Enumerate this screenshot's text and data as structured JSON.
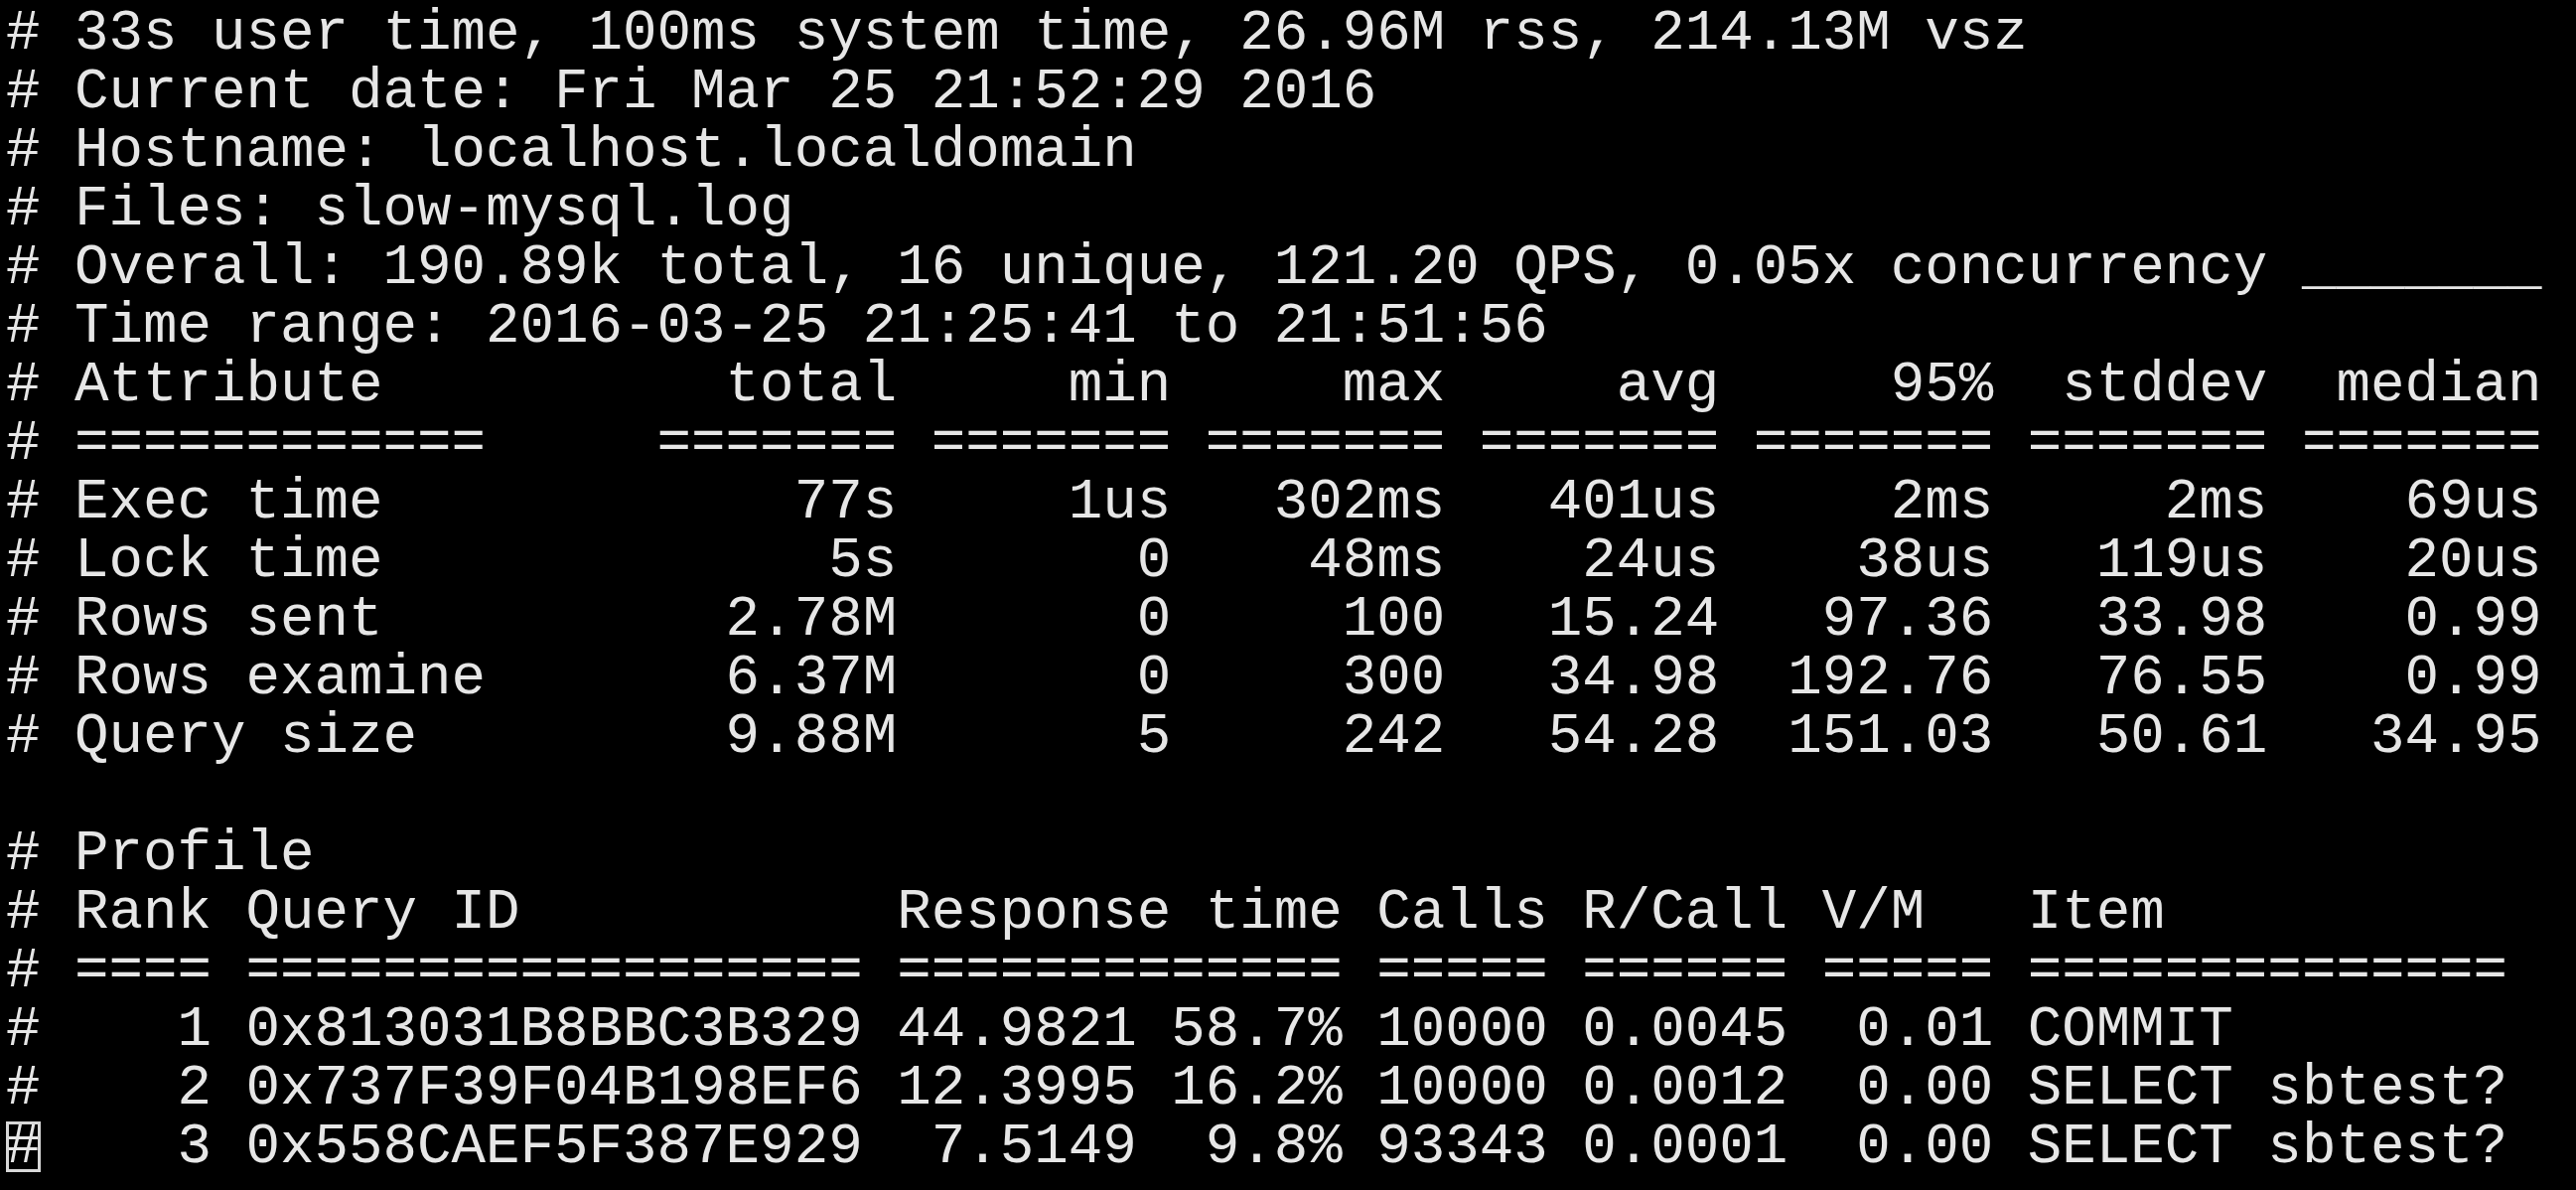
{
  "terminal": {
    "lines": [
      {
        "kind": "text",
        "text": "# 33s user time, 100ms system time, 26.96M rss, 214.13M vsz",
        "cursor": false
      },
      {
        "kind": "text",
        "text": "# Current date: Fri Mar 25 21:52:29 2016",
        "cursor": false
      },
      {
        "kind": "text",
        "text": "# Hostname: localhost.localdomain",
        "cursor": false
      },
      {
        "kind": "text",
        "text": "# Files: slow-mysql.log",
        "cursor": false
      },
      {
        "kind": "text",
        "text": "# Overall: 190.89k total, 16 unique, 121.20 QPS, 0.05x concurrency _______",
        "cursor": false
      },
      {
        "kind": "text",
        "text": "# Time range: 2016-03-25 21:25:41 to 21:51:56",
        "cursor": false
      },
      {
        "kind": "text",
        "text": "# Attribute          total     min     max     avg     95%  stddev  median",
        "cursor": false
      },
      {
        "kind": "text",
        "text": "# ============     ======= ======= ======= ======= ======= ======= =======",
        "cursor": false
      },
      {
        "kind": "text",
        "text": "# Exec time            77s     1us   302ms   401us     2ms     2ms    69us",
        "cursor": false
      },
      {
        "kind": "text",
        "text": "# Lock time             5s       0    48ms    24us    38us   119us    20us",
        "cursor": false
      },
      {
        "kind": "text",
        "text": "# Rows sent          2.78M       0     100   15.24   97.36   33.98    0.99",
        "cursor": false
      },
      {
        "kind": "text",
        "text": "# Rows examine       6.37M       0     300   34.98  192.76   76.55    0.99",
        "cursor": false
      },
      {
        "kind": "text",
        "text": "# Query size         9.88M       5     242   54.28  151.03   50.61   34.95",
        "cursor": false
      },
      {
        "kind": "blank"
      },
      {
        "kind": "text",
        "text": "# Profile",
        "cursor": false
      },
      {
        "kind": "text",
        "text": "# Rank Query ID           Response time Calls R/Call V/M   Item",
        "cursor": false
      },
      {
        "kind": "text",
        "text": "# ==== ================== ============= ===== ====== ===== ==============",
        "cursor": false
      },
      {
        "kind": "text",
        "text": "#    1 0x813031B8BBC3B329 44.9821 58.7% 10000 0.0045  0.01 COMMIT",
        "cursor": false
      },
      {
        "kind": "text",
        "text": "#    2 0x737F39F04B198EF6 12.3995 16.2% 10000 0.0012  0.00 SELECT sbtest?",
        "cursor": false
      },
      {
        "kind": "text",
        "text": "#    3 0x558CAEF5F387E929  7.5149  9.8% 93343 0.0001  0.00 SELECT sbtest?",
        "cursor": true
      }
    ]
  }
}
